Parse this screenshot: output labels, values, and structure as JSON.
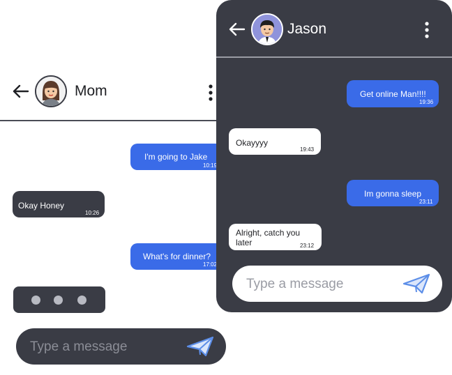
{
  "mom_chat": {
    "contact_name": "Mom",
    "messages": [
      {
        "text": "I'm going to Jake",
        "time": "10:19",
        "direction": "outgoing"
      },
      {
        "text": "Okay Honey",
        "time": "10:26",
        "direction": "incoming"
      },
      {
        "text": "What's for dinner?",
        "time": "17:02",
        "direction": "outgoing"
      }
    ],
    "typing_indicator": "dots",
    "input_placeholder": "Type a message"
  },
  "jason_chat": {
    "contact_name": "Jason",
    "messages": [
      {
        "text": "Get online Man!!!!",
        "time": "19:36",
        "direction": "outgoing"
      },
      {
        "text": "Okayyyy",
        "time": "19:43",
        "direction": "incoming"
      },
      {
        "text": "Im gonna sleep",
        "time": "23:11",
        "direction": "outgoing"
      },
      {
        "text": "Alright, catch you later",
        "time": "23:12",
        "direction": "incoming"
      }
    ],
    "input_placeholder": "Type a message"
  },
  "icons": [
    "back-arrow-icon",
    "more-vertical-icon",
    "send-icon",
    "avatar"
  ],
  "colors": {
    "accent_blue": "#3a6be8",
    "dark_panel": "#3a3c45",
    "send_icon_blue": "#5c8ee8"
  }
}
